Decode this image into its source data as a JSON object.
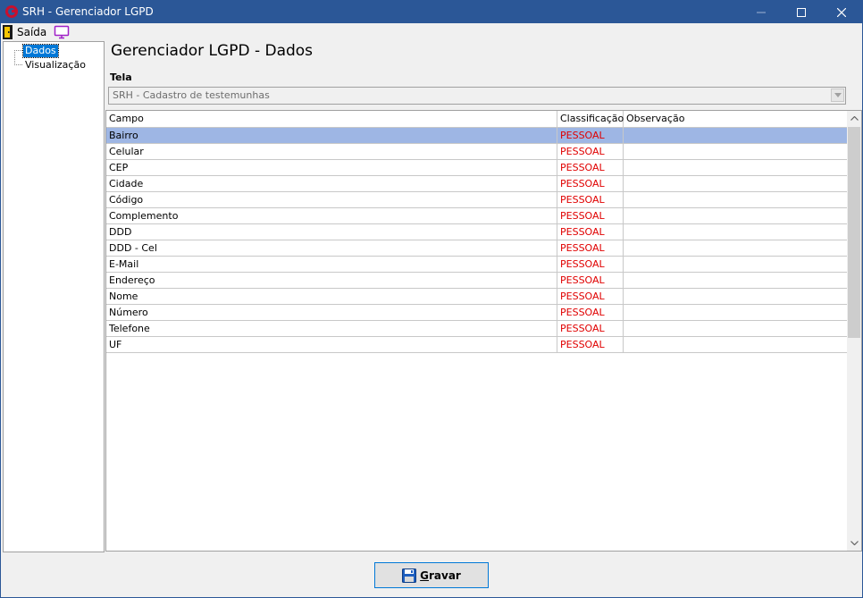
{
  "window": {
    "title": "SRH - Gerenciador LGPD"
  },
  "toolbar": {
    "exit_label": "Saída"
  },
  "tree": {
    "items": [
      {
        "label": "Dados",
        "selected": true
      },
      {
        "label": "Visualização",
        "selected": false
      }
    ]
  },
  "main": {
    "page_title": "Gerenciador LGPD - Dados",
    "tela_label": "Tela",
    "tela_value": "SRH - Cadastro de testemunhas"
  },
  "grid": {
    "columns": [
      "Campo",
      "Classificação",
      "Observação"
    ],
    "rows": [
      {
        "campo": "Bairro",
        "classificacao": "PESSOAL",
        "observacao": ""
      },
      {
        "campo": "Celular",
        "classificacao": "PESSOAL",
        "observacao": ""
      },
      {
        "campo": "CEP",
        "classificacao": "PESSOAL",
        "observacao": ""
      },
      {
        "campo": "Cidade",
        "classificacao": "PESSOAL",
        "observacao": ""
      },
      {
        "campo": "Código",
        "classificacao": "PESSOAL",
        "observacao": ""
      },
      {
        "campo": "Complemento",
        "classificacao": "PESSOAL",
        "observacao": ""
      },
      {
        "campo": "DDD",
        "classificacao": "PESSOAL",
        "observacao": ""
      },
      {
        "campo": "DDD - Cel",
        "classificacao": "PESSOAL",
        "observacao": ""
      },
      {
        "campo": "E-Mail",
        "classificacao": "PESSOAL",
        "observacao": ""
      },
      {
        "campo": "Endereço",
        "classificacao": "PESSOAL",
        "observacao": ""
      },
      {
        "campo": "Nome",
        "classificacao": "PESSOAL",
        "observacao": ""
      },
      {
        "campo": "Número",
        "classificacao": "PESSOAL",
        "observacao": ""
      },
      {
        "campo": "Telefone",
        "classificacao": "PESSOAL",
        "observacao": ""
      },
      {
        "campo": "UF",
        "classificacao": "PESSOAL",
        "observacao": ""
      }
    ],
    "selected_row": 0
  },
  "buttons": {
    "save_label_first": "G",
    "save_label_rest": "ravar"
  },
  "colors": {
    "titlebar": "#2b5797",
    "selection": "#9eb6e4",
    "classification_text": "#e00000",
    "tree_selection": "#0078d7"
  },
  "icons": {
    "app": "srh-logo-icon",
    "exit": "exit-door-icon",
    "screen": "monitor-icon",
    "save": "floppy-disk-icon"
  }
}
